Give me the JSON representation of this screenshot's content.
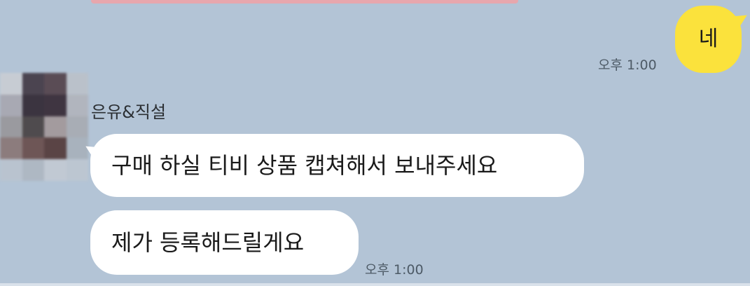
{
  "conversation": {
    "messages": [
      {
        "id": "m1",
        "direction": "outgoing",
        "text": "네",
        "time": "오후 1:00"
      },
      {
        "id": "group1",
        "direction": "incoming",
        "sender": "은유&직설",
        "bubbles": [
          {
            "text": "구매 하실 티비 상품 캡쳐해서 보내주세요"
          },
          {
            "text": "제가 등록해드릴게요"
          }
        ],
        "time": "오후 1:00"
      }
    ]
  },
  "colors": {
    "background": "#b3c4d6",
    "outgoing_bubble": "#fbe23c",
    "incoming_bubble": "#ffffff",
    "time_text": "#4d5a66"
  },
  "avatar": {
    "style": "pixelated-blur",
    "pixel_colors": [
      "#c7ccd3",
      "#4b4450",
      "#5a4c55",
      "#bac1ca",
      "#a8a9b3",
      "#3b3440",
      "#3f3541",
      "#b1b5be",
      "#9a9a9f",
      "#4f4b4e",
      "#a39b9e",
      "#a8adb5",
      "#8c7c7d",
      "#6e5656",
      "#5a4445",
      "#a8b2bd",
      "#b9c3cf",
      "#aeb8c3",
      "#c1c9d3",
      "#bcc6d1"
    ]
  }
}
